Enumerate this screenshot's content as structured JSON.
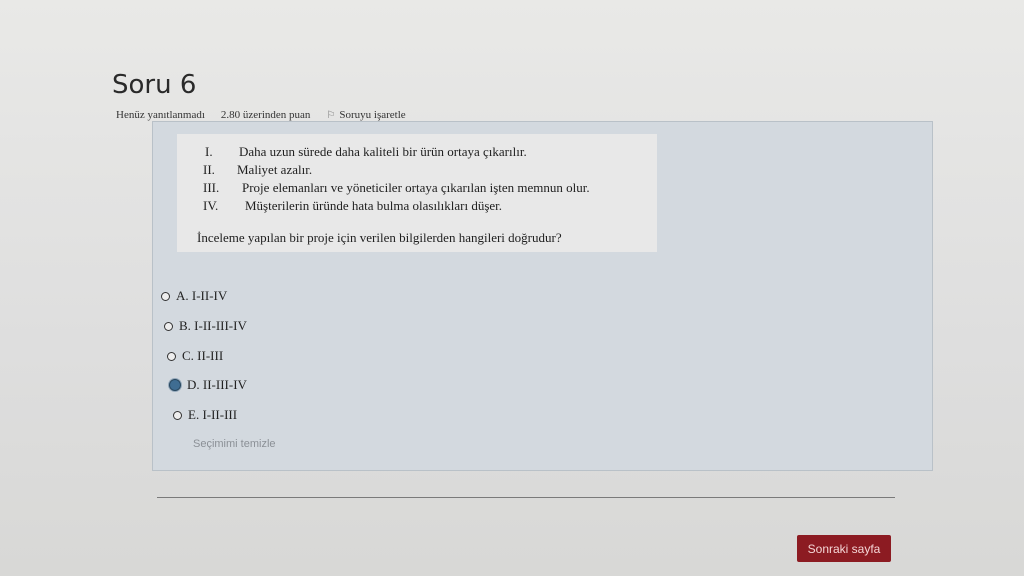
{
  "question": {
    "title": "Soru 6",
    "status": "Henüz yanıtlanmadı",
    "points": "2.80 üzerinden puan",
    "flag_label": "Soruyu işaretle",
    "statements": [
      {
        "num": "I.",
        "text": "Daha uzun sürede daha kaliteli bir ürün ortaya çıkarılır."
      },
      {
        "num": "II.",
        "text": "Maliyet azalır."
      },
      {
        "num": "III.",
        "text": "Proje elemanları ve yöneticiler ortaya çıkarılan işten memnun olur."
      },
      {
        "num": "IV.",
        "text": "Müşterilerin üründe hata bulma olasılıkları düşer."
      }
    ],
    "prompt": "İnceleme yapılan bir proje için verilen bilgilerden hangileri doğrudur?",
    "options": [
      {
        "label": "A. I-II-IV",
        "selected": false
      },
      {
        "label": "B. I-II-III-IV",
        "selected": false
      },
      {
        "label": "C. II-III",
        "selected": false
      },
      {
        "label": "D. II-III-IV",
        "selected": true
      },
      {
        "label": "E. I-II-III",
        "selected": false
      }
    ],
    "clear_label": "Seçimimi temizle"
  },
  "nav": {
    "next_label": "Sonraki sayfa"
  },
  "colors": {
    "next_button": "#8c1b22",
    "question_box": "#d3d9df"
  }
}
